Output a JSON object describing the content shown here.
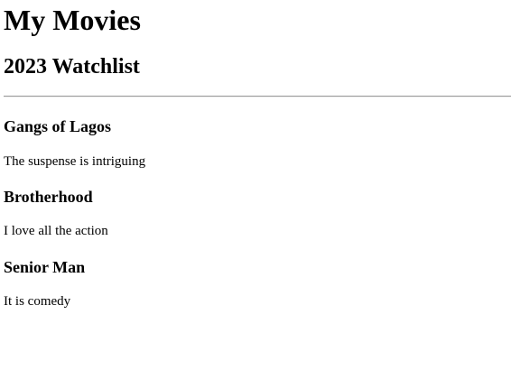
{
  "page": {
    "title": "My Movies",
    "subtitle": "2023 Watchlist"
  },
  "movies": [
    {
      "title": "Gangs of Lagos",
      "note": "The suspense is intriguing"
    },
    {
      "title": "Brotherhood",
      "note": "I love all the action"
    },
    {
      "title": "Senior Man",
      "note": "It is comedy"
    }
  ]
}
